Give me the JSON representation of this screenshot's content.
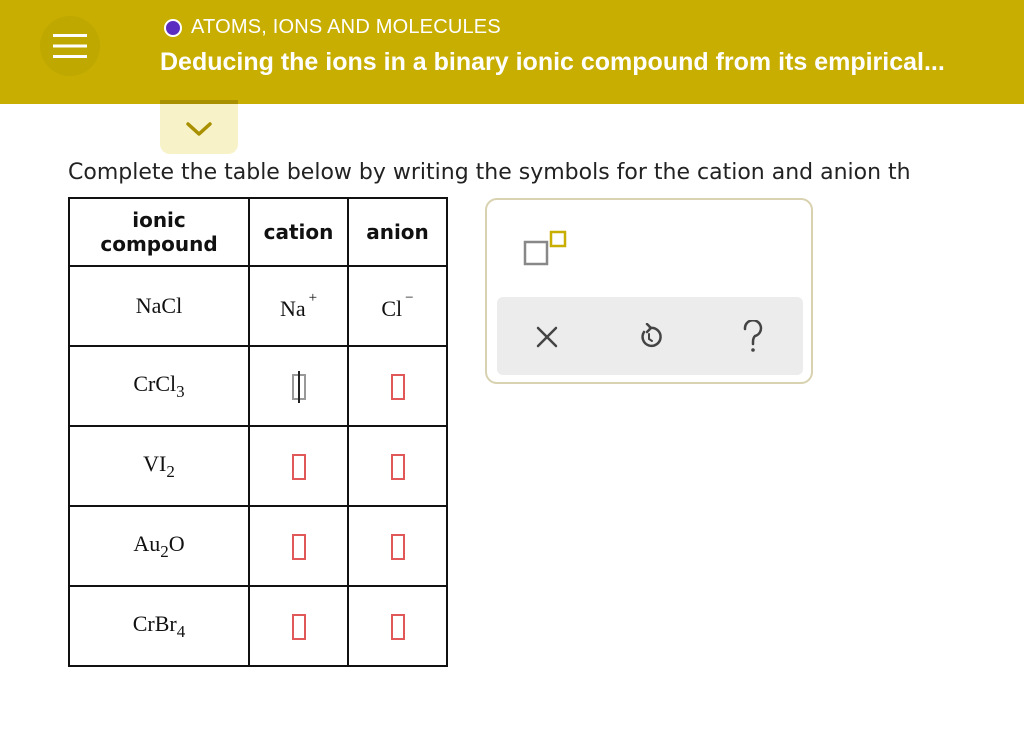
{
  "header": {
    "topic": "ATOMS, IONS AND MOLECULES",
    "title": "Deducing the ions in a binary ionic compound from its empirical...",
    "accent_color": "#c8ae00",
    "topic_dot_color": "#5b2ec1"
  },
  "instructions": "Complete the table below by writing the symbols for the cation and anion th",
  "table": {
    "headers": {
      "compound_line1": "ionic",
      "compound_line2": "compound",
      "cation": "cation",
      "anion": "anion"
    },
    "rows": [
      {
        "compound": "NaCl",
        "cation": "Na",
        "cation_charge": "+",
        "anion": "Cl",
        "anion_charge": "−"
      },
      {
        "compound_base": "CrCl",
        "compound_sub": "3"
      },
      {
        "compound_base": "VI",
        "compound_sub": "2"
      },
      {
        "compound_base": "Au",
        "compound_sub": "2",
        "compound_tail": "O"
      },
      {
        "compound_base": "CrBr",
        "compound_sub": "4"
      }
    ]
  },
  "tools": {
    "superscript": "superscript-box-icon",
    "clear": "close-icon",
    "undo": "undo-icon",
    "help": "help-icon"
  }
}
